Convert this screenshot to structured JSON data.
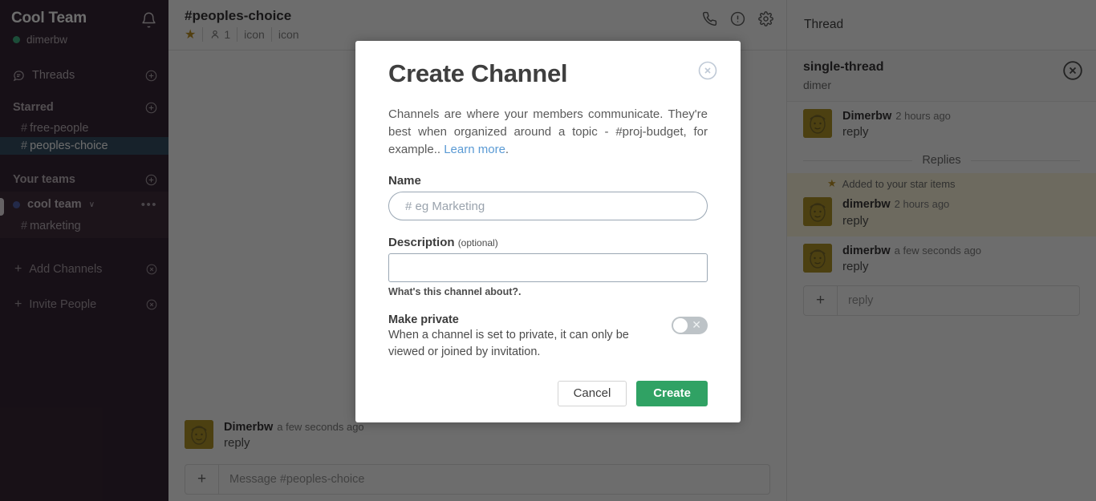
{
  "sidebar": {
    "team_name": "Cool Team",
    "notifications_icon": "bell-icon",
    "user": "dimerbw",
    "threads_label": "Threads",
    "starred_label": "Starred",
    "starred_channels": [
      {
        "name": "free-people",
        "active": false
      },
      {
        "name": "peoples-choice",
        "active": true
      }
    ],
    "your_teams_label": "Your teams",
    "team": {
      "name": "cool team",
      "caret": "∨",
      "more_icon": "•••",
      "channels": [
        {
          "name": "marketing"
        }
      ]
    },
    "actions": [
      {
        "label": "Add Channels",
        "icon": "plus-icon"
      },
      {
        "label": "Invite People",
        "icon": "plus-icon"
      }
    ]
  },
  "main": {
    "channel_title": "#peoples-choice",
    "meta": {
      "star_icon": "star-icon",
      "member_icon": "person-icon",
      "member_count": "1",
      "extra_1": "icon",
      "extra_2": "icon"
    },
    "header_icons": [
      "phone-icon",
      "info-icon",
      "gear-icon"
    ],
    "thread_label": "Thread",
    "message": {
      "author": "Dimerbw",
      "time": "a few seconds ago",
      "text": "reply"
    },
    "composer_placeholder": "Message #peoples-choice",
    "composer_plus": "+"
  },
  "thread": {
    "title": "single-thread",
    "subtitle": "dimer",
    "close_icon": "close-icon",
    "root_message": {
      "author": "Dimerbw",
      "time": "2 hours ago",
      "text": "reply"
    },
    "replies_divider": "Replies",
    "star_note": "Added to your star items",
    "replies": [
      {
        "author": "dimerbw",
        "time": "2 hours ago",
        "text": "reply",
        "starred": true
      },
      {
        "author": "dimerbw",
        "time": "a few seconds ago",
        "text": "reply",
        "starred": false
      }
    ],
    "composer_placeholder": "reply",
    "composer_plus": "+"
  },
  "modal": {
    "title": "Create Channel",
    "close_icon": "close-circle-icon",
    "description_part1": "Channels are where your members communicate. They're best when organized around a topic - #proj-budget, for example.. ",
    "description_link": "Learn more",
    "description_part2": ".",
    "name_label": "Name",
    "name_placeholder": "# eg Marketing",
    "name_value": "",
    "description_label": "Description",
    "description_optional": "(optional)",
    "description_value": "",
    "description_hint": "What's this channel about?.",
    "private_title": "Make private",
    "private_desc": "When a channel is set to private, it can only be viewed or joined by invitation.",
    "private_toggle_state": "off",
    "private_toggle_glyph": "✕",
    "cancel_label": "Cancel",
    "create_label": "Create"
  },
  "colors": {
    "sidebar_bg": "#1f0d1d",
    "active_channel_bg": "#1f3a51",
    "create_button": "#30a264",
    "link": "#5a9ad4",
    "star_highlight": "#fff8d9",
    "avatar_bg": "#a8880f",
    "presence_online": "#2bac76"
  }
}
